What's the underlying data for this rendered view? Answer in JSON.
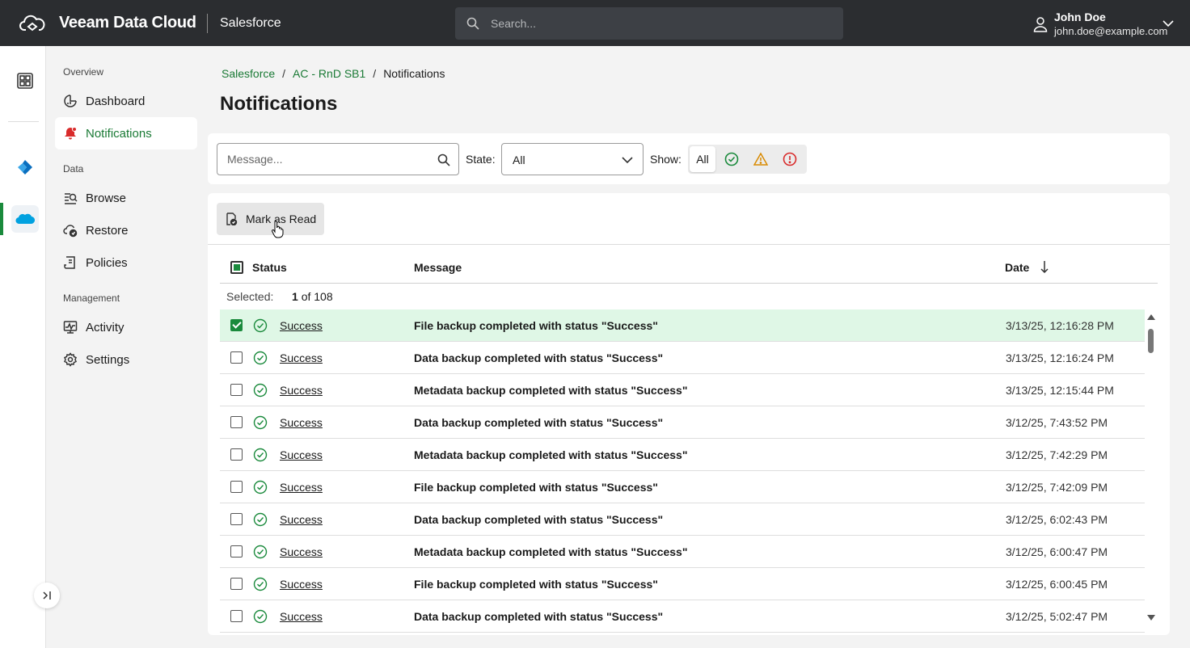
{
  "app": {
    "brand": "Veeam Data Cloud",
    "product": "Salesforce",
    "search_placeholder": "Search...",
    "user": {
      "name": "John Doe",
      "email": "john.doe@example.com"
    },
    "accent_color": "#1a8a3c"
  },
  "rail": {
    "items": [
      {
        "icon": "dashboard-grid-icon"
      },
      {
        "icon": "azure-icon"
      },
      {
        "icon": "salesforce-icon",
        "active": true
      }
    ]
  },
  "sidebar": {
    "sections": [
      {
        "label": "Overview",
        "items": [
          {
            "label": "Dashboard",
            "icon": "dashboard-icon"
          },
          {
            "label": "Notifications",
            "icon": "bell-icon",
            "active": true
          }
        ]
      },
      {
        "label": "Data",
        "items": [
          {
            "label": "Browse",
            "icon": "browse-icon"
          },
          {
            "label": "Restore",
            "icon": "restore-icon"
          },
          {
            "label": "Policies",
            "icon": "policies-icon"
          }
        ]
      },
      {
        "label": "Management",
        "items": [
          {
            "label": "Activity",
            "icon": "activity-icon"
          },
          {
            "label": "Settings",
            "icon": "gear-icon"
          }
        ]
      }
    ]
  },
  "breadcrumb": [
    "Salesforce",
    "AC - RnD SB1",
    "Notifications"
  ],
  "page_title": "Notifications",
  "filters": {
    "message_placeholder": "Message...",
    "state_label": "State:",
    "state_value": "All",
    "show_label": "Show:",
    "show_all": "All"
  },
  "toolbar": {
    "mark_as_read": "Mark as Read"
  },
  "table": {
    "columns": {
      "status": "Status",
      "message": "Message",
      "date": "Date"
    },
    "selected_label": "Selected:",
    "selected_count": "1",
    "selected_total": "of 108",
    "rows": [
      {
        "status": "Success",
        "message": "File backup completed with status \"Success\"",
        "date": "3/13/25, 12:16:28 PM",
        "selected": true
      },
      {
        "status": "Success",
        "message": "Data backup completed with status \"Success\"",
        "date": "3/13/25, 12:16:24 PM"
      },
      {
        "status": "Success",
        "message": "Metadata backup completed with status \"Success\"",
        "date": "3/13/25, 12:15:44 PM"
      },
      {
        "status": "Success",
        "message": "Data backup completed with status \"Success\"",
        "date": "3/12/25, 7:43:52 PM"
      },
      {
        "status": "Success",
        "message": "Metadata backup completed with status \"Success\"",
        "date": "3/12/25, 7:42:29 PM"
      },
      {
        "status": "Success",
        "message": "File backup completed with status \"Success\"",
        "date": "3/12/25, 7:42:09 PM"
      },
      {
        "status": "Success",
        "message": "Data backup completed with status \"Success\"",
        "date": "3/12/25, 6:02:43 PM"
      },
      {
        "status": "Success",
        "message": "Metadata backup completed with status \"Success\"",
        "date": "3/12/25, 6:00:47 PM"
      },
      {
        "status": "Success",
        "message": "File backup completed with status \"Success\"",
        "date": "3/12/25, 6:00:45 PM"
      },
      {
        "status": "Success",
        "message": "Data backup completed with status \"Success\"",
        "date": "3/12/25, 5:02:47 PM"
      }
    ]
  }
}
